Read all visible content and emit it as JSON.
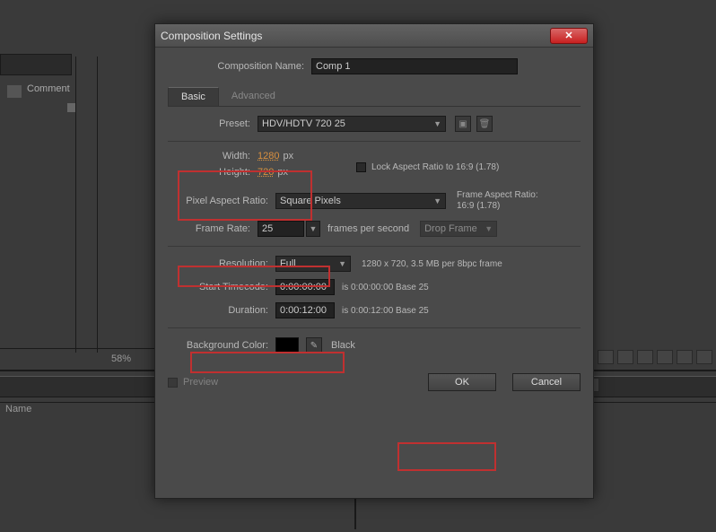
{
  "bg": {
    "comment_header": "Comment",
    "zoom": "58%",
    "name_header": "Name"
  },
  "dialog": {
    "title": "Composition Settings",
    "name_label": "Composition Name:",
    "name_value": "Comp 1",
    "tabs": {
      "basic": "Basic",
      "advanced": "Advanced"
    },
    "preset": {
      "label": "Preset:",
      "value": "HDV/HDTV 720 25"
    },
    "width": {
      "label": "Width:",
      "value": "1280",
      "unit": "px"
    },
    "height": {
      "label": "Height:",
      "value": "720",
      "unit": "px"
    },
    "lock_ar": "Lock Aspect Ratio to 16:9 (1.78)",
    "par": {
      "label": "Pixel Aspect Ratio:",
      "value": "Square Pixels",
      "info_label": "Frame Aspect Ratio:",
      "info_value": "16:9 (1.78)"
    },
    "framerate": {
      "label": "Frame Rate:",
      "value": "25",
      "unit": "frames per second",
      "drop": "Drop Frame"
    },
    "resolution": {
      "label": "Resolution:",
      "value": "Full",
      "info": "1280 x 720, 3.5 MB per 8bpc frame"
    },
    "start_tc": {
      "label": "Start Timecode:",
      "value": "0:00:00:00",
      "info": "is 0:00:00:00  Base 25"
    },
    "duration": {
      "label": "Duration:",
      "value": "0:00:12:00",
      "info": "is 0:00:12:00  Base 25"
    },
    "bgcolor": {
      "label": "Background Color:",
      "name": "Black",
      "hex": "#000000"
    },
    "preview": "Preview",
    "ok": "OK",
    "cancel": "Cancel"
  }
}
